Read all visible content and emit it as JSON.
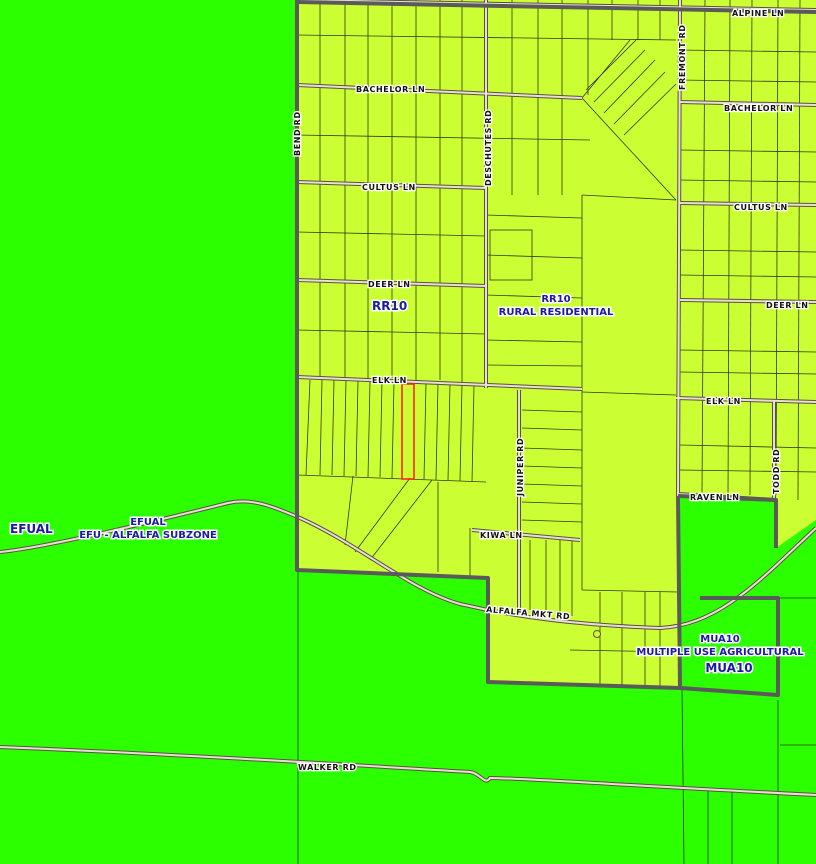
{
  "colors": {
    "efu_zone": "#2bff00",
    "residential_zone": "#ccff33",
    "zone_boundary": "#5a5a5a",
    "parcel_line": "#2f3a1a",
    "road_line": "#7a6a5a",
    "selected_parcel": "#ff1a1a",
    "zone_label_text": "#1a1aa6"
  },
  "roads": {
    "alpine": "ALPINE LN",
    "bachelor_west": "BACHELOR LN",
    "bachelor_east": "BACHELOR LN",
    "fremont": "FREMONT RD",
    "bend": "BEND RD",
    "deschutes": "DESCHUTES RD",
    "cultus_west": "CULTUS LN",
    "cultus_east": "CULTUS LN",
    "deer_west": "DEER LN",
    "deer_east": "DEER LN",
    "elk_west": "ELK LN",
    "elk_east": "ELK LN",
    "juniper": "JUNIPER RD",
    "todd": "TODD RD",
    "raven": "RAVEN LN",
    "kiwa": "KIWA LN",
    "alfalfa_mkt": "ALFALFA MKT RD",
    "walker": "WALKER RD"
  },
  "zones": {
    "rr10_short": "RR10",
    "rr10_code": "RR10",
    "rr10_name": "RURAL RESIDENTIAL",
    "efual_short": "EFUAL",
    "efual_code": "EFUAL",
    "efual_name": "EFU - ALFALFA SUBZONE",
    "mua10_code": "MUA10",
    "mua10_name": "MULTIPLE USE AGRICULTURAL",
    "mua10_short": "MUA10"
  },
  "selected_parcel": {
    "highlighted": true
  }
}
